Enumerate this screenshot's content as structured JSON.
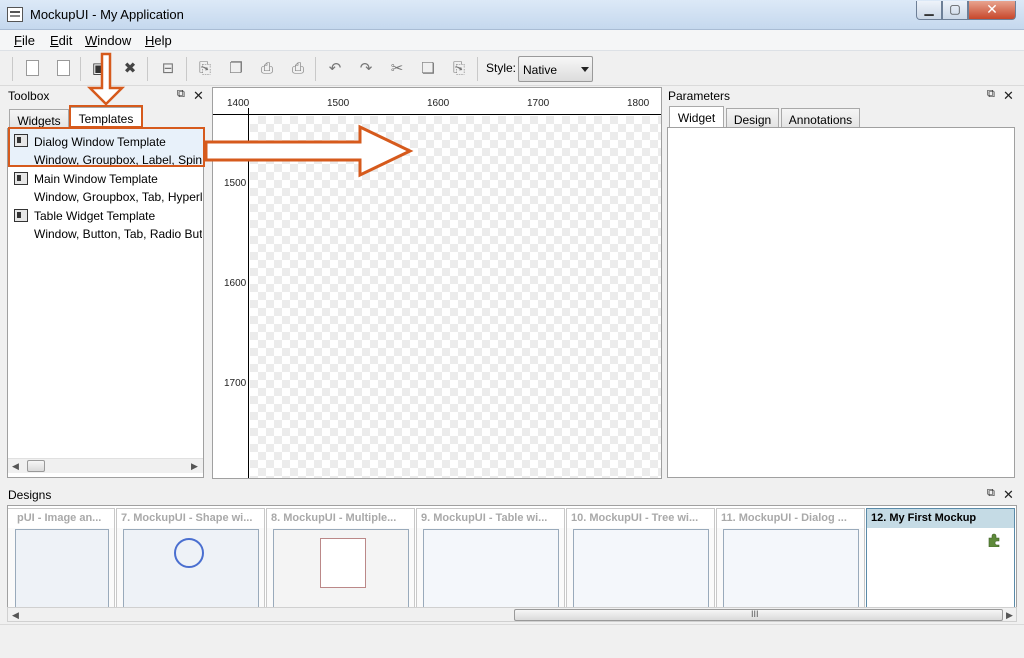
{
  "window": {
    "title": "MockupUI - My Application"
  },
  "menu": {
    "items": [
      "File",
      "Edit",
      "Window",
      "Help"
    ]
  },
  "toolbar": {
    "style_label": "Style:",
    "style_value": "Native"
  },
  "toolbox": {
    "title": "Toolbox",
    "tabs": [
      "Widgets",
      "Templates"
    ],
    "templates": [
      {
        "name": "Dialog Window Template",
        "desc": "Window, Groupbox, Label, Spin Bo"
      },
      {
        "name": "Main Window Template",
        "desc": "Window, Groupbox, Tab, Hyperlink"
      },
      {
        "name": "Table Widget Template",
        "desc": "Window, Button, Tab, Radio Buttor"
      }
    ]
  },
  "canvas": {
    "ruler_x": [
      "1400",
      "1500",
      "1600",
      "1700",
      "1800"
    ],
    "ruler_y": [
      "1500",
      "1600",
      "1700"
    ]
  },
  "parameters": {
    "title": "Parameters",
    "tabs": [
      "Widget",
      "Design",
      "Annotations"
    ]
  },
  "designs": {
    "title": "Designs",
    "items": [
      "pUI - Image an...",
      "7. MockupUI - Shape wi...",
      "8. MockupUI - Multiple...",
      "9. MockupUI - Table wi...",
      "10. MockupUI - Tree wi...",
      "11. MockupUI - Dialog ...",
      "12. My First Mockup"
    ],
    "scroll_grip": "III"
  },
  "colors": {
    "highlight": "#d65a1c",
    "current_design": "#c5dbe5"
  }
}
